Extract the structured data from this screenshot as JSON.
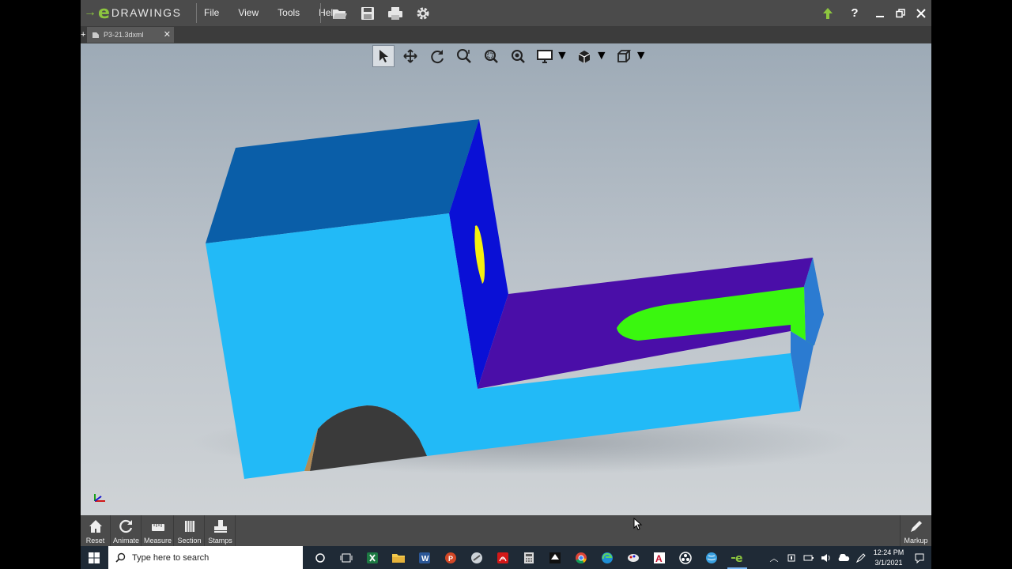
{
  "app": {
    "logo_text": "DRAWINGS",
    "logo_letter": "e",
    "menu": [
      "File",
      "View",
      "Tools",
      "Help"
    ],
    "quick_access": [
      "open-icon",
      "save-icon",
      "print-icon",
      "settings-icon"
    ],
    "window_controls": [
      "update-icon",
      "help-icon",
      "minimize-icon",
      "restore-icon",
      "close-icon"
    ]
  },
  "tab": {
    "label": "P3-21.3dxml"
  },
  "view_toolbar": [
    "select-icon",
    "pan-icon",
    "rotate-icon",
    "zoom-to-fit-icon",
    "zoom-to-area-icon",
    "zoom-icon",
    "display-style-icon",
    "view-orientation-icon",
    "standard-views-icon"
  ],
  "model": {
    "colors": {
      "front": "#22baf7",
      "top": "#0a5ea8",
      "side_dark": "#0a10d6",
      "slot_face": "#4a0ea8",
      "slot_end": "#2b7bd1",
      "slot_inner": "#3af70f",
      "hole": "#f5f00f",
      "arch": "#3a3a3a"
    }
  },
  "bottom_toolbar": [
    {
      "label": "Reset",
      "icon": "home-icon"
    },
    {
      "label": "Animate",
      "icon": "animate-icon"
    },
    {
      "label": "Measure",
      "icon": "measure-icon"
    },
    {
      "label": "Section",
      "icon": "section-icon"
    },
    {
      "label": "Stamps",
      "icon": "stamps-icon"
    }
  ],
  "markup": {
    "label": "Markup",
    "icon": "pencil-icon"
  },
  "taskbar": {
    "search_placeholder": "Type here to search",
    "apps": [
      "cortana-icon",
      "task-view-icon",
      "excel-icon",
      "file-explorer-icon",
      "word-icon",
      "powerpoint-icon",
      "snipping-icon",
      "acrobat-icon",
      "calculator-icon",
      "inkscape-icon",
      "chrome-icon",
      "edge-icon",
      "paint-icon",
      "autocad-icon",
      "obs-icon",
      "globe-icon",
      "edrawings-icon"
    ],
    "time": "12:24 PM",
    "date": "3/1/2021"
  }
}
